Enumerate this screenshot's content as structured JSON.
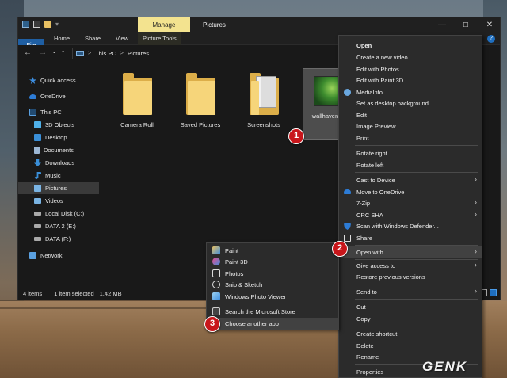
{
  "window": {
    "title": "Pictures",
    "ribbon_context_tab": "Manage",
    "tabs": [
      "File",
      "Home",
      "Share",
      "View",
      "Picture Tools"
    ],
    "controls": {
      "minimize": "—",
      "maximize": "☐",
      "close": "✕"
    },
    "help": "?"
  },
  "address": {
    "back": "←",
    "forward": "→",
    "dropdown": "⌄",
    "up": "↑",
    "crumbs": [
      "This PC",
      "Pictures"
    ],
    "sep": ">"
  },
  "sidebar": {
    "items": [
      {
        "label": "Quick access",
        "icon": "star-icon",
        "color": "#3d8ee0"
      },
      {
        "label": "OneDrive",
        "icon": "cloud-icon",
        "color": "#2d7cd6"
      },
      {
        "label": "This PC",
        "icon": "pc-icon",
        "color": "#5aa0e0"
      },
      {
        "label": "3D Objects",
        "icon": "cube-icon",
        "color": "#4fb0e8"
      },
      {
        "label": "Desktop",
        "icon": "desktop-icon",
        "color": "#3a8fd8"
      },
      {
        "label": "Documents",
        "icon": "document-icon",
        "color": "#9cb7d4"
      },
      {
        "label": "Downloads",
        "icon": "download-icon",
        "color": "#3a8fd8"
      },
      {
        "label": "Music",
        "icon": "music-icon",
        "color": "#3a8fd8"
      },
      {
        "label": "Pictures",
        "icon": "picture-icon",
        "color": "#7ab4e4"
      },
      {
        "label": "Videos",
        "icon": "video-icon",
        "color": "#7ab4e4"
      },
      {
        "label": "Local Disk (C:)",
        "icon": "drive-icon",
        "color": "#aaaaaa"
      },
      {
        "label": "DATA 2 (E:)",
        "icon": "drive-icon",
        "color": "#aaaaaa"
      },
      {
        "label": "DATA (F:)",
        "icon": "drive-icon",
        "color": "#aaaaaa"
      },
      {
        "label": "Network",
        "icon": "network-icon",
        "color": "#5aa0e0"
      }
    ]
  },
  "files": [
    {
      "name": "Camera Roll"
    },
    {
      "name": "Saved Pictures"
    },
    {
      "name": "Screenshots"
    },
    {
      "name": "wallhaven-7...8"
    }
  ],
  "status": {
    "count": "4 items",
    "selection": "1 item selected",
    "size": "1.42 MB"
  },
  "context_menu": {
    "items": [
      {
        "label": "Open",
        "bold": true
      },
      {
        "label": "Create a new video"
      },
      {
        "label": "Edit with Photos"
      },
      {
        "label": "Edit with Paint 3D"
      },
      {
        "label": "MediaInfo",
        "icon": "mediainfo-icon"
      },
      {
        "label": "Set as desktop background"
      },
      {
        "label": "Edit"
      },
      {
        "label": "Image Preview"
      },
      {
        "label": "Print"
      },
      {
        "label": "Rotate right"
      },
      {
        "label": "Rotate left"
      },
      {
        "label": "Cast to Device",
        "submenu": true
      },
      {
        "label": "Move to OneDrive",
        "icon": "onedrive-icon"
      },
      {
        "label": "7-Zip",
        "submenu": true
      },
      {
        "label": "CRC SHA",
        "submenu": true
      },
      {
        "label": "Scan with Windows Defender...",
        "icon": "defender-icon"
      },
      {
        "label": "Share",
        "icon": "share-icon"
      },
      {
        "label": "Open with",
        "submenu": true
      },
      {
        "label": "Give access to",
        "submenu": true
      },
      {
        "label": "Restore previous versions"
      },
      {
        "label": "Send to",
        "submenu": true
      },
      {
        "label": "Cut"
      },
      {
        "label": "Copy"
      },
      {
        "label": "Create shortcut"
      },
      {
        "label": "Delete"
      },
      {
        "label": "Rename"
      },
      {
        "label": "Properties"
      }
    ]
  },
  "open_with_menu": {
    "items": [
      {
        "label": "Paint",
        "icon": "paint-icon"
      },
      {
        "label": "Paint 3D",
        "icon": "paint3d-icon"
      },
      {
        "label": "Photos",
        "icon": "photos-icon"
      },
      {
        "label": "Snip & Sketch",
        "icon": "snip-icon"
      },
      {
        "label": "Windows Photo Viewer",
        "icon": "photo-viewer-icon"
      },
      {
        "label": "Search the Microsoft Store",
        "icon": "store-icon"
      },
      {
        "label": "Choose another app"
      }
    ]
  },
  "steps": [
    "1",
    "2",
    "3"
  ],
  "logo": "GENK"
}
